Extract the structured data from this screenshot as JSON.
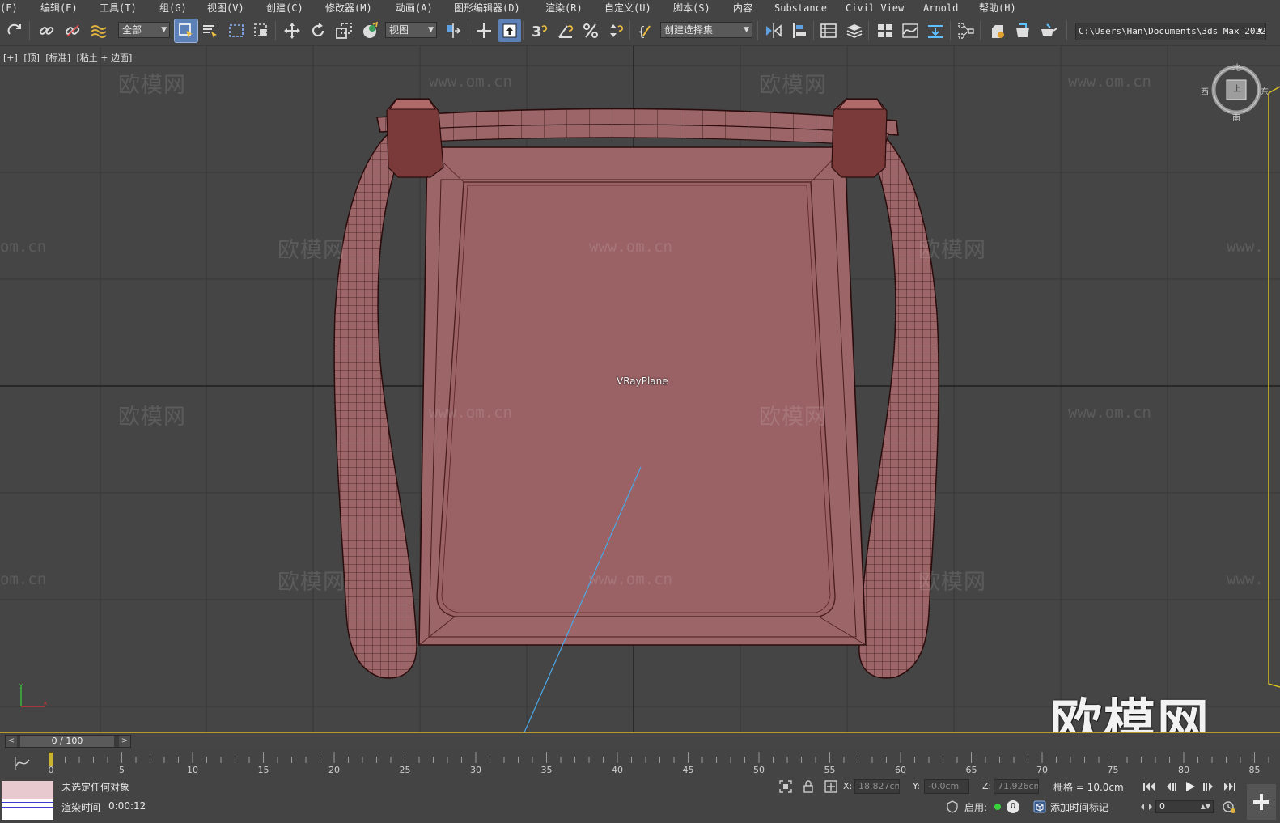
{
  "menu": {
    "items": [
      {
        "label": "(F)"
      },
      {
        "label": "编辑(E)"
      },
      {
        "label": "工具(T)"
      },
      {
        "label": "组(G)"
      },
      {
        "label": "视图(V)"
      },
      {
        "label": "创建(C)"
      },
      {
        "label": "修改器(M)"
      },
      {
        "label": "动画(A)"
      },
      {
        "label": "图形编辑器(D)"
      },
      {
        "label": "渲染(R)"
      },
      {
        "label": "自定义(U)"
      },
      {
        "label": "脚本(S)"
      },
      {
        "label": "内容"
      },
      {
        "label": "Substance"
      },
      {
        "label": "Civil View"
      },
      {
        "label": "Arnold"
      },
      {
        "label": "帮助(H)"
      }
    ]
  },
  "toolbar": {
    "selection_filter": "全部",
    "reference_coord": "视图",
    "named_selection": "创建选择集",
    "snap_label": "3",
    "project_path": "C:\\Users\\Han\\Documents\\3ds Max 2022",
    "icons": [
      "redo-icon",
      "link-icon",
      "unlink-icon",
      "bind-spacewarp-icon",
      "select-object-icon",
      "select-by-name-icon",
      "rect-region-icon",
      "window-crossing-icon",
      "move-icon",
      "rotate-icon",
      "scale-icon",
      "placement-icon",
      "pivot-icon",
      "manipulate-icon",
      "keyboard-shortcut-icon",
      "snap-toggle-icon",
      "angle-snap-icon",
      "percent-snap-icon",
      "spinner-snap-icon",
      "edit-named-selection-icon",
      "mirror-icon",
      "align-icon",
      "layer-explorer-icon",
      "layers-icon",
      "scene-explorer-icon",
      "curve-editor-icon",
      "dope-sheet-icon",
      "schematic-view-icon",
      "render-setup-icon",
      "rendered-frame-icon",
      "render-icon"
    ]
  },
  "viewport": {
    "labels": [
      "[+]",
      "[顶]",
      "[标准]",
      "[粘土 + 边面]"
    ],
    "object_name": "VRayPlane",
    "viewcube": {
      "top": "北",
      "left": "西",
      "right": "东",
      "bottom": "南",
      "face": "上"
    },
    "watermark_cn": "欧模网",
    "watermark_url": "www.om.cn",
    "watermark_url_partial": "om.cn",
    "watermark_url_cut": "www.",
    "logo": "欧模网",
    "model_color": "#9c6568",
    "wire_color": "#3a1616",
    "grid_color": "#2c2c2c"
  },
  "timeline": {
    "frame_display": "0 / 100",
    "prev": "<",
    "next": ">",
    "ticks": [
      "0",
      "5",
      "10",
      "15",
      "20",
      "25",
      "30",
      "35",
      "40",
      "45",
      "50",
      "55",
      "60",
      "65",
      "70",
      "75",
      "80",
      "85"
    ]
  },
  "status": {
    "selection_msg": "未选定任何对象",
    "render_time_label": "渲染时间",
    "render_time_value": "0:00:12",
    "x_label": "X:",
    "x_value": "18.827cm",
    "y_label": "Y:",
    "y_value": "-0.0cm",
    "z_label": "Z:",
    "z_value": "71.926cm",
    "grid_label": "栅格 = 10.0cm",
    "enable_label": "启用:",
    "enable_count": "0",
    "add_time_tag": "添加时间标记",
    "current_frame": "0",
    "accent_color": "#b49a2a",
    "enabled_dot_color": "#3ad23a"
  }
}
